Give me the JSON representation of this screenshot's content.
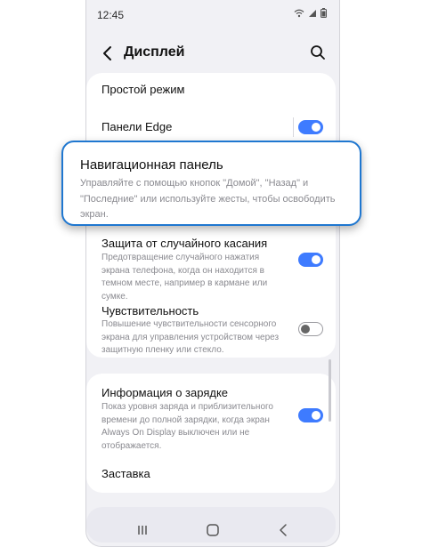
{
  "status_bar": {
    "time": "12:45",
    "icons": [
      "wifi-icon",
      "signal-icon",
      "battery-icon"
    ]
  },
  "header": {
    "title": "Дисплей",
    "back_icon": "back-arrow-icon",
    "search_icon": "search-icon"
  },
  "settings": {
    "easy_mode": {
      "title": "Простой режим"
    },
    "edge_panels": {
      "title": "Панели Edge",
      "toggle": true
    },
    "navigation_bar": {
      "title": "Навигационная панель",
      "subtitle": "Управляйте с помощью кнопок \"Домой\", \"Назад\" и \"Последние\" или используйте жесты, чтобы освободить экран."
    },
    "accidental_touch": {
      "title": "Защита от случайного касания",
      "subtitle": "Предотвращение случайного нажатия экрана телефона, когда он находится в темном месте, например в кармане или сумке.",
      "toggle": true
    },
    "touch_sensitivity": {
      "title": "Чувствительность",
      "subtitle": "Повышение чувствительности сенсорного экрана для управления устройством через защитную пленку или стекло.",
      "toggle": false
    },
    "charging_info": {
      "title": "Информация о зарядке",
      "subtitle": "Показ уровня заряда и приблизительного времени до полной зарядки, когда экран Always On Display выключен или не отображается.",
      "toggle": true
    },
    "screen_saver": {
      "title": "Заставка"
    }
  },
  "navigation_bar_buttons": [
    "recents-icon",
    "home-icon",
    "back-icon"
  ],
  "colors": {
    "accent": "#3e7bff",
    "callout_border": "#1f77d0",
    "background": "#f1f1f5",
    "card": "#ffffff",
    "subtext": "#8a8a90"
  }
}
